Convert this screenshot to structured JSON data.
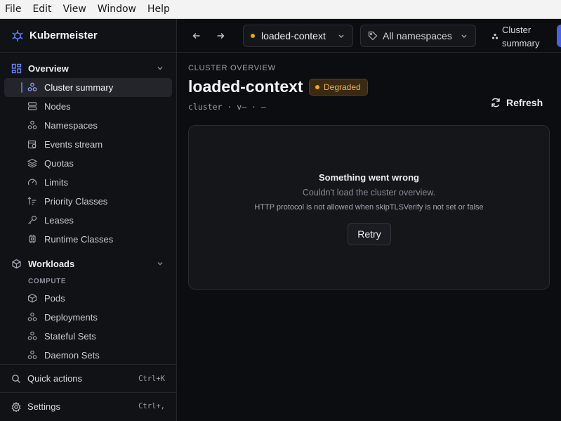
{
  "menubar": {
    "items": [
      "File",
      "Edit",
      "View",
      "Window",
      "Help"
    ]
  },
  "app": {
    "name": "Kubermeister",
    "accent": "#4f6cf0"
  },
  "sidebar": {
    "sections": [
      {
        "label": "Overview",
        "items": [
          {
            "label": "Cluster summary",
            "icon": "cluster-icon",
            "active": true
          },
          {
            "label": "Nodes",
            "icon": "server-icon"
          },
          {
            "label": "Namespaces",
            "icon": "cubes-icon"
          },
          {
            "label": "Events stream",
            "icon": "calendar-clock-icon"
          },
          {
            "label": "Quotas",
            "icon": "layers-icon"
          },
          {
            "label": "Limits",
            "icon": "gauge-icon"
          },
          {
            "label": "Priority Classes",
            "icon": "sort-icon"
          },
          {
            "label": "Leases",
            "icon": "key-icon"
          },
          {
            "label": "Runtime Classes",
            "icon": "chip-icon"
          }
        ]
      },
      {
        "label": "Workloads",
        "group": "COMPUTE",
        "items": [
          {
            "label": "Pods",
            "icon": "cube-icon"
          },
          {
            "label": "Deployments",
            "icon": "cubes-icon"
          },
          {
            "label": "Stateful Sets",
            "icon": "cubes-icon"
          },
          {
            "label": "Daemon Sets",
            "icon": "cubes-icon"
          }
        ]
      }
    ],
    "bottom": [
      {
        "label": "Quick actions",
        "shortcut": "Ctrl+K",
        "icon": "search-icon"
      },
      {
        "label": "Settings",
        "shortcut": "Ctrl+,",
        "icon": "gear-icon"
      }
    ]
  },
  "toolbar": {
    "context": "loaded-context",
    "context_status_color": "#f0a500",
    "namespace": "All namespaces",
    "crumb": "Cluster summary"
  },
  "main": {
    "eyebrow": "CLUSTER OVERVIEW",
    "title": "loaded-context",
    "status": "Degraded",
    "meta": "cluster · v— · —",
    "refresh_label": "Refresh",
    "error": {
      "title": "Something went wrong",
      "subtitle": "Couldn't load the cluster overview.",
      "detail": "HTTP protocol is not allowed when skipTLSVerify is not set or false",
      "retry_label": "Retry"
    }
  }
}
